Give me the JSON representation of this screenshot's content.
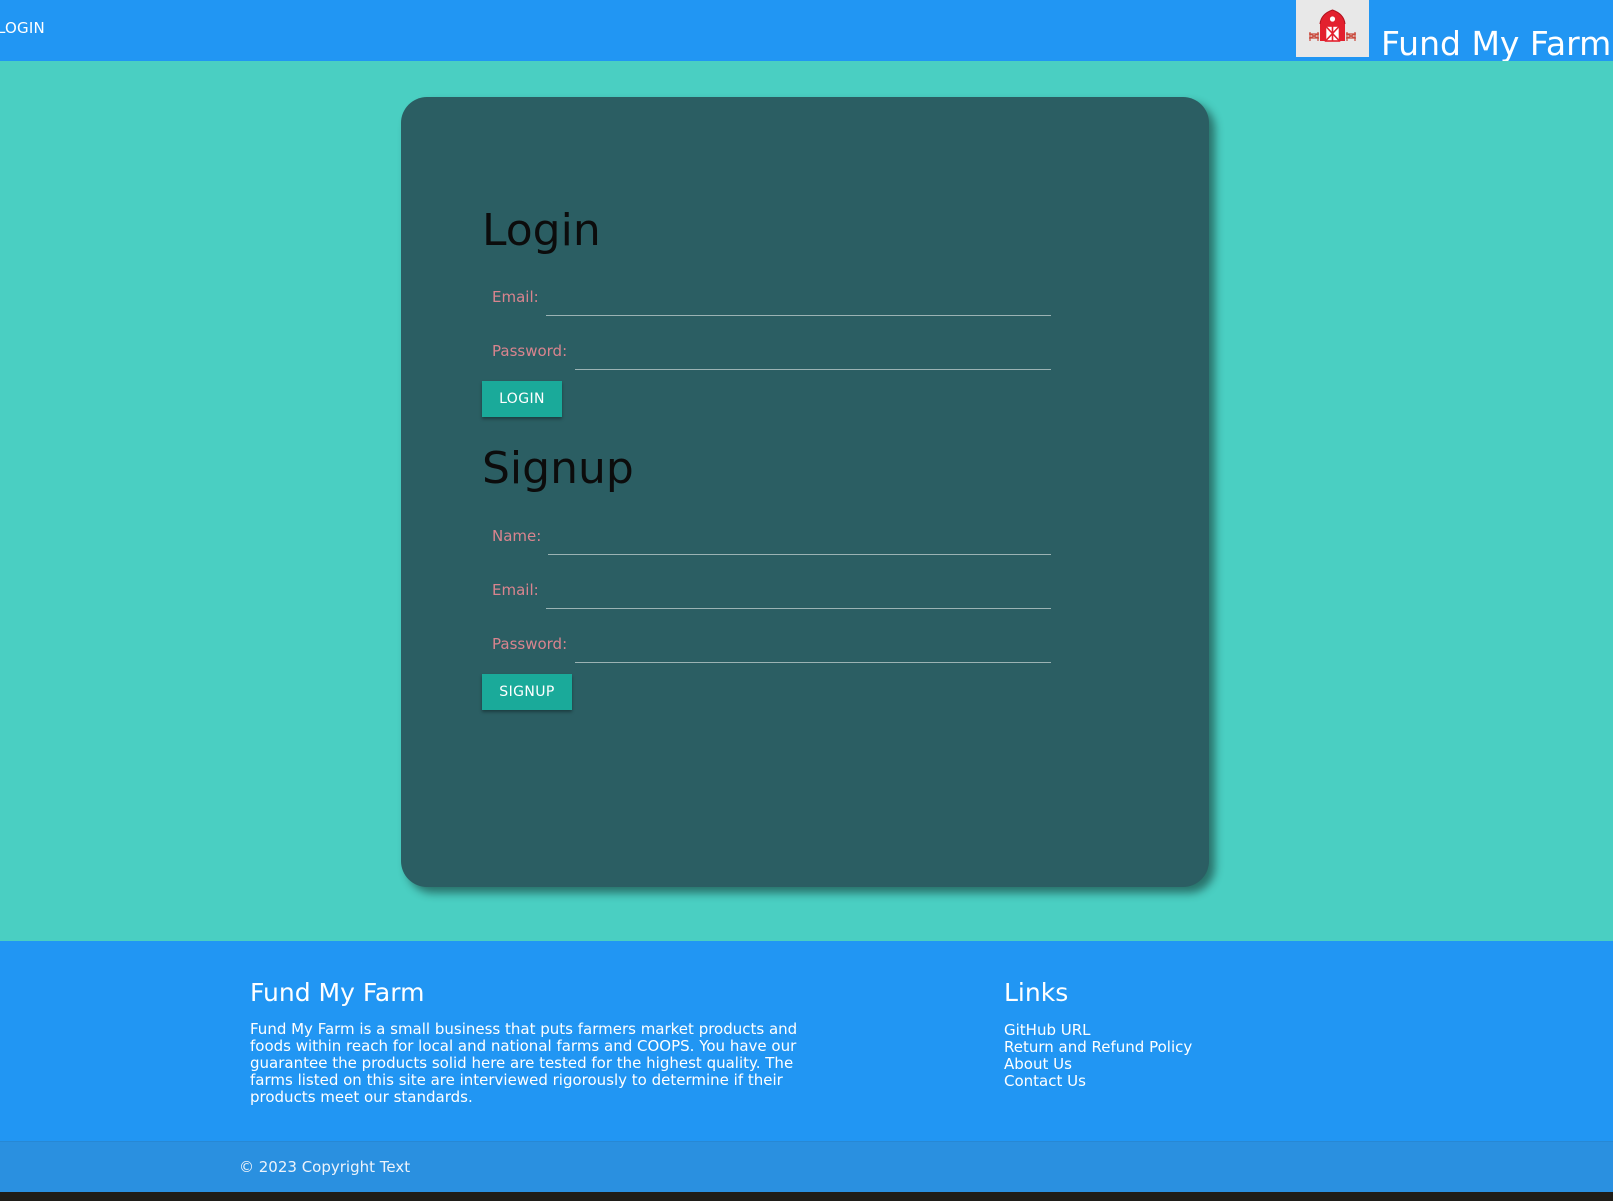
{
  "nav": {
    "link_label": "LOGIN",
    "brand": "Fund My Farm",
    "logo_icon": "barn-icon"
  },
  "login": {
    "title": "Login",
    "email_label": "Email:",
    "email_value": "",
    "password_label": "Password:",
    "password_value": "",
    "button_label": "LOGIN"
  },
  "signup": {
    "title": "Signup",
    "name_label": "Name:",
    "name_value": "",
    "email_label": "Email:",
    "email_value": "",
    "password_label": "Password:",
    "password_value": "",
    "button_label": "SIGNUP"
  },
  "footer": {
    "about_title": "Fund My Farm",
    "about_text": "Fund My Farm is a small business that puts farmers market products and foods within reach for local and national farms and COOPS. You have our guarantee the products solid here are tested for the highest quality. The farms listed on this site are interviewed rigorously to determine if their products meet our standards.",
    "links_title": "Links",
    "links": [
      "GitHub URL",
      "Return and Refund Policy",
      "About Us",
      "Contact Us"
    ],
    "copyright": "© 2023 Copyright Text"
  },
  "colors": {
    "nav_bg": "#2196f3",
    "page_bg": "#4acfc2",
    "card_bg": "#2b5e63",
    "label": "#d9848e",
    "button": "#1aaa9a"
  }
}
